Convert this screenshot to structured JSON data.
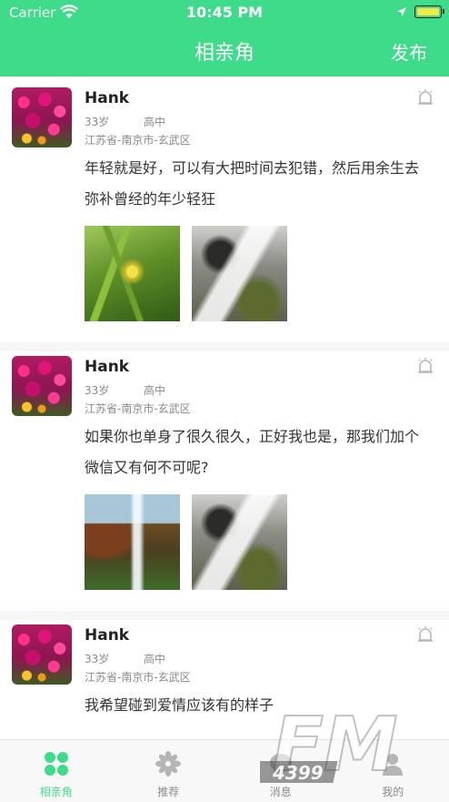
{
  "status_bar": {
    "carrier": "Carrier",
    "time": "10:45 PM"
  },
  "header": {
    "title": "相亲角",
    "publish_label": "发布"
  },
  "colors": {
    "accent": "#3ddb8a",
    "tab_active": "#3ddb8a",
    "text_secondary": "#8a8a8a"
  },
  "posts": [
    {
      "name": "Hank",
      "age": "33岁",
      "education": "高中",
      "location": "江苏省-南京市-玄武区",
      "text": "年轻就是好，可以有大把时间去犯错，然后用余生去弥补曾经的年少轻狂",
      "images": [
        "leaf-photo",
        "waterfall-photo"
      ]
    },
    {
      "name": "Hank",
      "age": "33岁",
      "education": "高中",
      "location": "江苏省-南京市-玄武区",
      "text": "如果你也单身了很久很久，正好我也是，那我们加个微信又有何不可呢?",
      "images": [
        "cliff-waterfall-photo",
        "waterfall-photo"
      ]
    },
    {
      "name": "Hank",
      "age": "33岁",
      "education": "高中",
      "location": "江苏省-南京市-玄武区",
      "text": "我希望碰到爱情应该有的样子",
      "images": []
    }
  ],
  "tabbar": {
    "items": [
      {
        "label": "相亲角",
        "icon": "grid-icon",
        "active": true
      },
      {
        "label": "推荐",
        "icon": "pinwheel-icon",
        "active": false
      },
      {
        "label": "消息",
        "icon": "chat-icon",
        "active": false
      },
      {
        "label": "我的",
        "icon": "user-icon",
        "active": false
      }
    ]
  },
  "watermark": {
    "brand": "FM",
    "number": "4399"
  }
}
